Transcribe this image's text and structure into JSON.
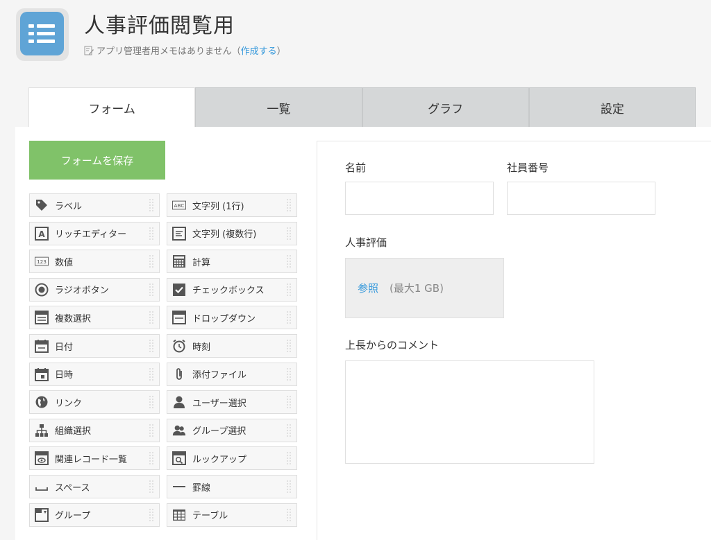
{
  "app": {
    "title": "人事評価閲覧用",
    "memo_text": "アプリ管理者用メモはありません（",
    "memo_link": "作成する",
    "memo_close": "）"
  },
  "tabs": [
    {
      "label": "フォーム",
      "active": true
    },
    {
      "label": "一覧",
      "active": false
    },
    {
      "label": "グラフ",
      "active": false
    },
    {
      "label": "設定",
      "active": false
    }
  ],
  "save_button": "フォームを保存",
  "palette": [
    {
      "label": "ラベル",
      "icon": "tag-icon"
    },
    {
      "label": "文字列 (1行)",
      "icon": "abc-icon"
    },
    {
      "label": "リッチエディター",
      "icon": "rich-editor-icon"
    },
    {
      "label": "文字列 (複数行)",
      "icon": "multiline-text-icon"
    },
    {
      "label": "数値",
      "icon": "number-123-icon"
    },
    {
      "label": "計算",
      "icon": "calculator-icon"
    },
    {
      "label": "ラジオボタン",
      "icon": "radio-icon"
    },
    {
      "label": "チェックボックス",
      "icon": "checkbox-icon"
    },
    {
      "label": "複数選択",
      "icon": "multi-select-icon"
    },
    {
      "label": "ドロップダウン",
      "icon": "dropdown-icon"
    },
    {
      "label": "日付",
      "icon": "calendar-icon"
    },
    {
      "label": "時刻",
      "icon": "clock-icon"
    },
    {
      "label": "日時",
      "icon": "datetime-icon"
    },
    {
      "label": "添付ファイル",
      "icon": "paperclip-icon"
    },
    {
      "label": "リンク",
      "icon": "globe-icon"
    },
    {
      "label": "ユーザー選択",
      "icon": "user-icon"
    },
    {
      "label": "組織選択",
      "icon": "org-icon"
    },
    {
      "label": "グループ選択",
      "icon": "group-icon"
    },
    {
      "label": "関連レコード一覧",
      "icon": "related-records-icon"
    },
    {
      "label": "ルックアップ",
      "icon": "lookup-icon"
    },
    {
      "label": "スペース",
      "icon": "space-icon"
    },
    {
      "label": "罫線",
      "icon": "line-icon"
    },
    {
      "label": "グループ",
      "icon": "group-folder-icon"
    },
    {
      "label": "テーブル",
      "icon": "table-icon"
    }
  ],
  "form": {
    "name_label": "名前",
    "employee_no_label": "社員番号",
    "review_label": "人事評価",
    "upload_link": "参照",
    "upload_note": "(最大1 GB)",
    "comment_label": "上長からのコメント"
  },
  "colors": {
    "accent_green": "#80c269",
    "link_blue": "#3498db",
    "app_icon_blue": "#5fa4d6"
  }
}
